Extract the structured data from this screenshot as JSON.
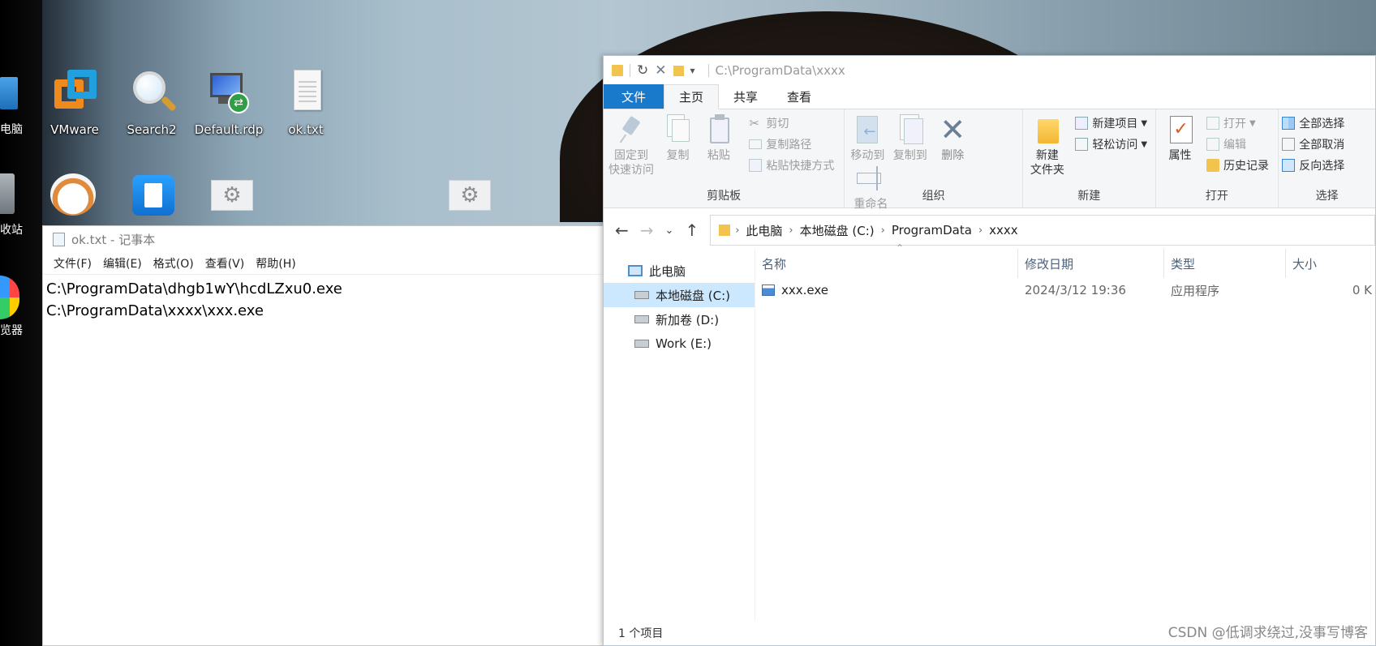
{
  "desktop": {
    "partial_labels": [
      "电脑",
      "收站",
      "览器"
    ],
    "icons": [
      {
        "name": "vmware-icon",
        "label": "VMware"
      },
      {
        "name": "search2-icon",
        "label": "Search2"
      },
      {
        "name": "rdp-icon",
        "label": "Default.rdp"
      },
      {
        "name": "txt-file-icon",
        "label": "ok.txt"
      }
    ]
  },
  "notepad": {
    "title": "ok.txt - 记事本",
    "menu": [
      "文件(F)",
      "编辑(E)",
      "格式(O)",
      "查看(V)",
      "帮助(H)"
    ],
    "lines": [
      "C:\\ProgramData\\dhgb1wY\\hcdLZxu0.exe",
      "C:\\ProgramData\\xxxx\\xxx.exe"
    ]
  },
  "explorer": {
    "title_path": "C:\\ProgramData\\xxxx",
    "tabs": [
      "文件",
      "主页",
      "共享",
      "查看"
    ],
    "ribbon": {
      "clipboard": {
        "label": "剪贴板",
        "pin": "固定到快速访问",
        "pin_1": "固定到",
        "pin_2": "快速访问",
        "copy": "复制",
        "paste": "粘贴",
        "cut": "剪切",
        "copy_path": "复制路径",
        "paste_shortcut": "粘贴快捷方式"
      },
      "organize": {
        "label": "组织",
        "move_to": "移动到",
        "copy_to": "复制到",
        "delete": "删除",
        "rename": "重命名"
      },
      "new": {
        "label": "新建",
        "new_folder_1": "新建",
        "new_folder_2": "文件夹",
        "new_item": "新建项目",
        "easy_access": "轻松访问"
      },
      "open": {
        "label": "打开",
        "properties": "属性",
        "open": "打开",
        "edit": "编辑",
        "history": "历史记录"
      },
      "select": {
        "label": "选择",
        "select_all": "全部选择",
        "select_none": "全部取消",
        "invert": "反向选择"
      }
    },
    "breadcrumb": [
      "此电脑",
      "本地磁盘 (C:)",
      "ProgramData",
      "xxxx"
    ],
    "nav": [
      "此电脑",
      "本地磁盘 (C:)",
      "新加卷 (D:)",
      "Work (E:)"
    ],
    "columns": {
      "name": "名称",
      "date": "修改日期",
      "type": "类型",
      "size": "大小"
    },
    "files": [
      {
        "name": "xxx.exe",
        "date": "2024/3/12 19:36",
        "type": "应用程序",
        "size": "0 K"
      }
    ],
    "status": "1 个项目"
  },
  "watermark": "CSDN @低调求绕过,没事写博客"
}
